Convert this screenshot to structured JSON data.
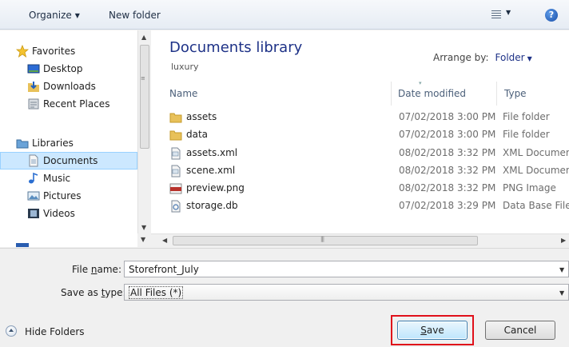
{
  "toolbar": {
    "organize_label": "Organize",
    "new_folder_label": "New folder",
    "help_label": "?"
  },
  "nav": {
    "items": [
      {
        "label": "Favorites",
        "icon": "star-icon"
      },
      {
        "label": "Desktop",
        "icon": "desktop-icon"
      },
      {
        "label": "Downloads",
        "icon": "downloads-icon"
      },
      {
        "label": "Recent Places",
        "icon": "recent-places-icon"
      },
      {
        "label": "Libraries",
        "icon": "libraries-icon"
      },
      {
        "label": "Documents",
        "icon": "documents-icon",
        "selected": true
      },
      {
        "label": "Music",
        "icon": "music-icon"
      },
      {
        "label": "Pictures",
        "icon": "pictures-icon"
      },
      {
        "label": "Videos",
        "icon": "videos-icon"
      }
    ]
  },
  "content": {
    "title": "Documents library",
    "subtitle": "luxury",
    "arrange_label": "Arrange by:",
    "arrange_value": "Folder",
    "columns": {
      "name": "Name",
      "date": "Date modified",
      "type": "Type"
    },
    "rows": [
      {
        "name": "assets",
        "date": "07/02/2018 3:00 PM",
        "type": "File folder",
        "icon": "folder-icon"
      },
      {
        "name": "data",
        "date": "07/02/2018 3:00 PM",
        "type": "File folder",
        "icon": "folder-icon"
      },
      {
        "name": "assets.xml",
        "date": "08/02/2018 3:32 PM",
        "type": "XML Document",
        "icon": "xml-file-icon"
      },
      {
        "name": "scene.xml",
        "date": "08/02/2018 3:32 PM",
        "type": "XML Document",
        "icon": "xml-file-icon"
      },
      {
        "name": "preview.png",
        "date": "08/02/2018 3:32 PM",
        "type": "PNG Image",
        "icon": "png-file-icon"
      },
      {
        "name": "storage.db",
        "date": "07/02/2018 3:29 PM",
        "type": "Data Base File",
        "icon": "db-file-icon"
      }
    ]
  },
  "form": {
    "file_name_label_pre": "File ",
    "file_name_label_u": "n",
    "file_name_label_post": "ame:",
    "file_name_value": "Storefront_July",
    "save_type_label_pre": "Save as ",
    "save_type_label_u": "t",
    "save_type_label_post": "ype:",
    "save_type_value": "All Files (*)"
  },
  "footer": {
    "hide_folders_label": "Hide Folders",
    "save_label_u": "S",
    "save_label_post": "ave",
    "cancel_label": "Cancel"
  },
  "colors": {
    "selection": "#cce8ff",
    "title_blue": "#1e3287",
    "highlight_red": "#e0101a"
  }
}
